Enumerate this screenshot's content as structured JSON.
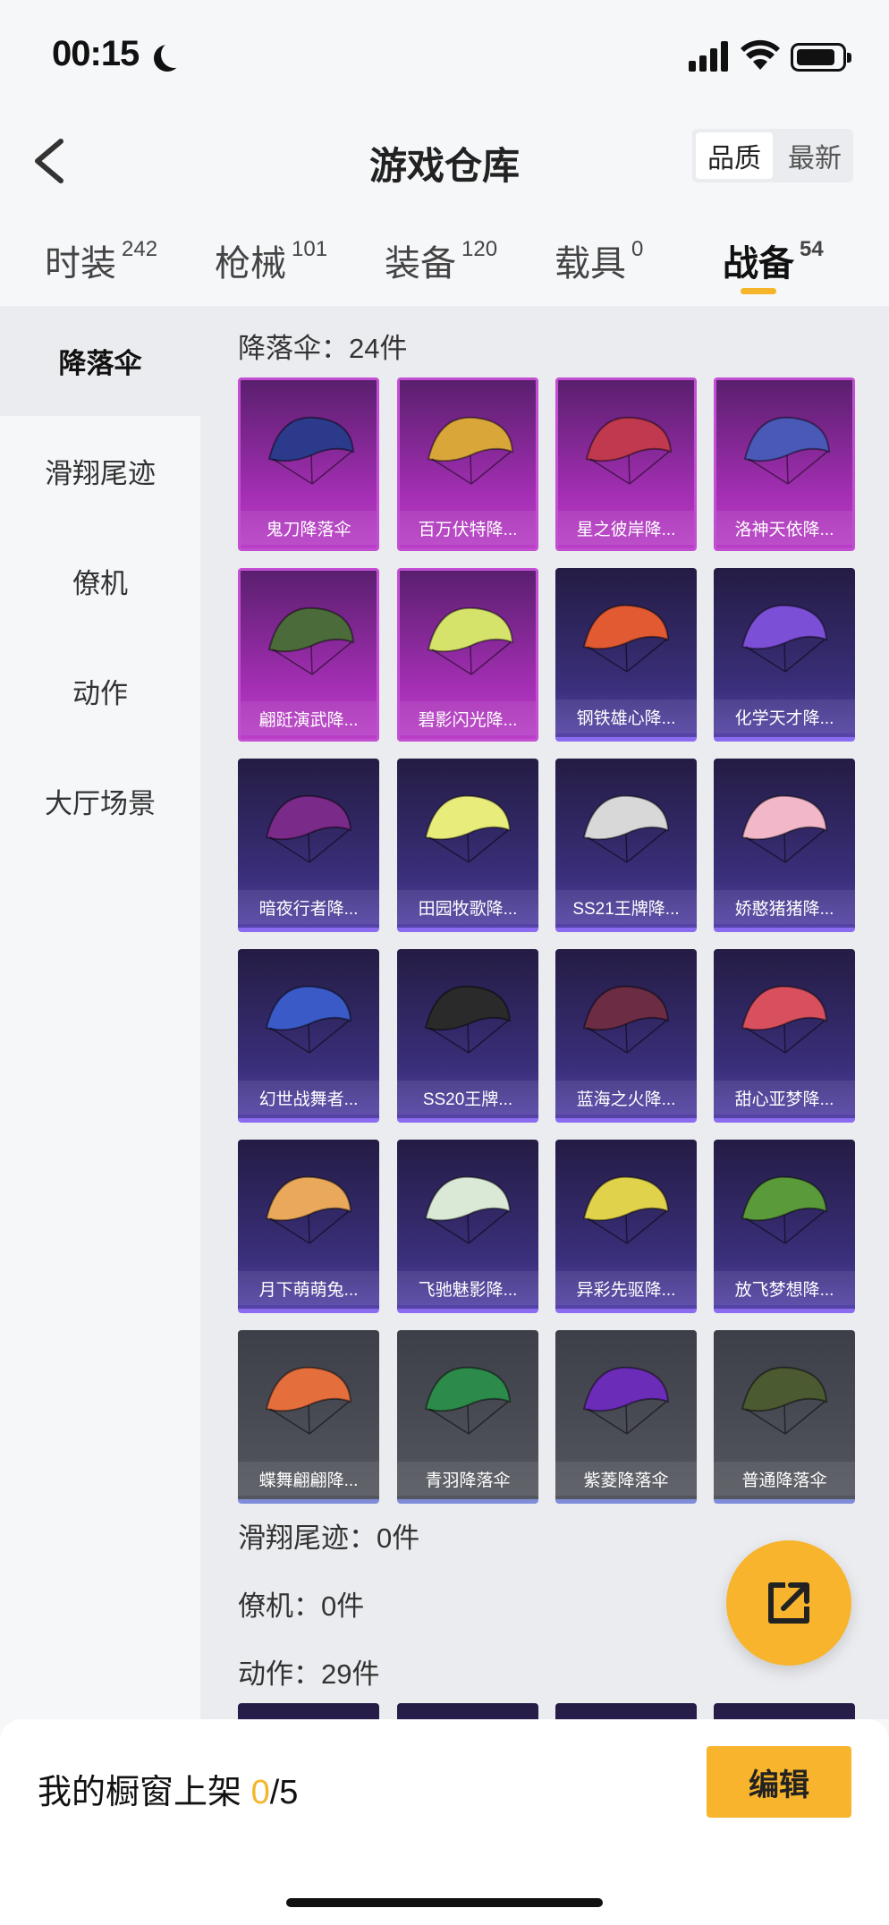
{
  "status_bar": {
    "time": "00:15"
  },
  "header": {
    "title": "游戏仓库",
    "sort_options": [
      "品质",
      "最新"
    ]
  },
  "tabs": [
    {
      "label": "时装",
      "count": "242"
    },
    {
      "label": "枪械",
      "count": "101"
    },
    {
      "label": "装备",
      "count": "120"
    },
    {
      "label": "载具",
      "count": "0"
    },
    {
      "label": "战备",
      "count": "54"
    }
  ],
  "sidebar": {
    "items": [
      "降落伞",
      "滑翔尾迹",
      "僚机",
      "动作",
      "大厅场景"
    ]
  },
  "sections": {
    "parachute": "降落伞：24件",
    "trail": "滑翔尾迹：0件",
    "wingman": "僚机：0件",
    "emote": "动作：29件"
  },
  "items": [
    {
      "name": "鬼刀降落伞",
      "rarity": "purple",
      "color": "#2b3a8a"
    },
    {
      "name": "百万伏特降...",
      "rarity": "purple",
      "color": "#d9a63a"
    },
    {
      "name": "星之彼岸降...",
      "rarity": "purple",
      "color": "#c0394e"
    },
    {
      "name": "洛神天依降...",
      "rarity": "purple",
      "color": "#4a58b8"
    },
    {
      "name": "翩跹演武降...",
      "rarity": "purple",
      "color": "#4c6b3a"
    },
    {
      "name": "碧影闪光降...",
      "rarity": "purple",
      "color": "#d6e36a"
    },
    {
      "name": "钢铁雄心降...",
      "rarity": "blue",
      "color": "#e15a32"
    },
    {
      "name": "化学天才降...",
      "rarity": "blue",
      "color": "#7b4fd6"
    },
    {
      "name": "暗夜行者降...",
      "rarity": "blue",
      "color": "#7a2a88"
    },
    {
      "name": "田园牧歌降...",
      "rarity": "blue",
      "color": "#e8ec7a"
    },
    {
      "name": "SS21王牌降...",
      "rarity": "blue",
      "color": "#d8d8d8"
    },
    {
      "name": "娇憨猪猪降...",
      "rarity": "blue",
      "color": "#f2b7c8"
    },
    {
      "name": "幻世战舞者...",
      "rarity": "blue",
      "color": "#3a5ac8"
    },
    {
      "name": "SS20王牌...",
      "rarity": "blue",
      "color": "#2a2a2a"
    },
    {
      "name": "蓝海之火降...",
      "rarity": "blue",
      "color": "#6b2c44"
    },
    {
      "name": "甜心亚梦降...",
      "rarity": "blue",
      "color": "#d8505e"
    },
    {
      "name": "月下萌萌兔...",
      "rarity": "blue",
      "color": "#e9a85a"
    },
    {
      "name": "飞驰魅影降...",
      "rarity": "blue",
      "color": "#d9e9d6"
    },
    {
      "name": "异彩先驱降...",
      "rarity": "blue",
      "color": "#e0d24a"
    },
    {
      "name": "放飞梦想降...",
      "rarity": "blue",
      "color": "#5a9a3a"
    },
    {
      "name": "蝶舞翩翩降...",
      "rarity": "grey",
      "color": "#e46e3c"
    },
    {
      "name": "青羽降落伞",
      "rarity": "grey",
      "color": "#2c8a4a"
    },
    {
      "name": "紫菱降落伞",
      "rarity": "grey",
      "color": "#6b2cb8"
    },
    {
      "name": "普通降落伞",
      "rarity": "grey",
      "color": "#4c5a32"
    }
  ],
  "footer": {
    "label": "我的橱窗上架",
    "count": "0",
    "total": "/5",
    "edit_label": "编辑"
  },
  "colors": {
    "accent": "#f5b52a"
  }
}
